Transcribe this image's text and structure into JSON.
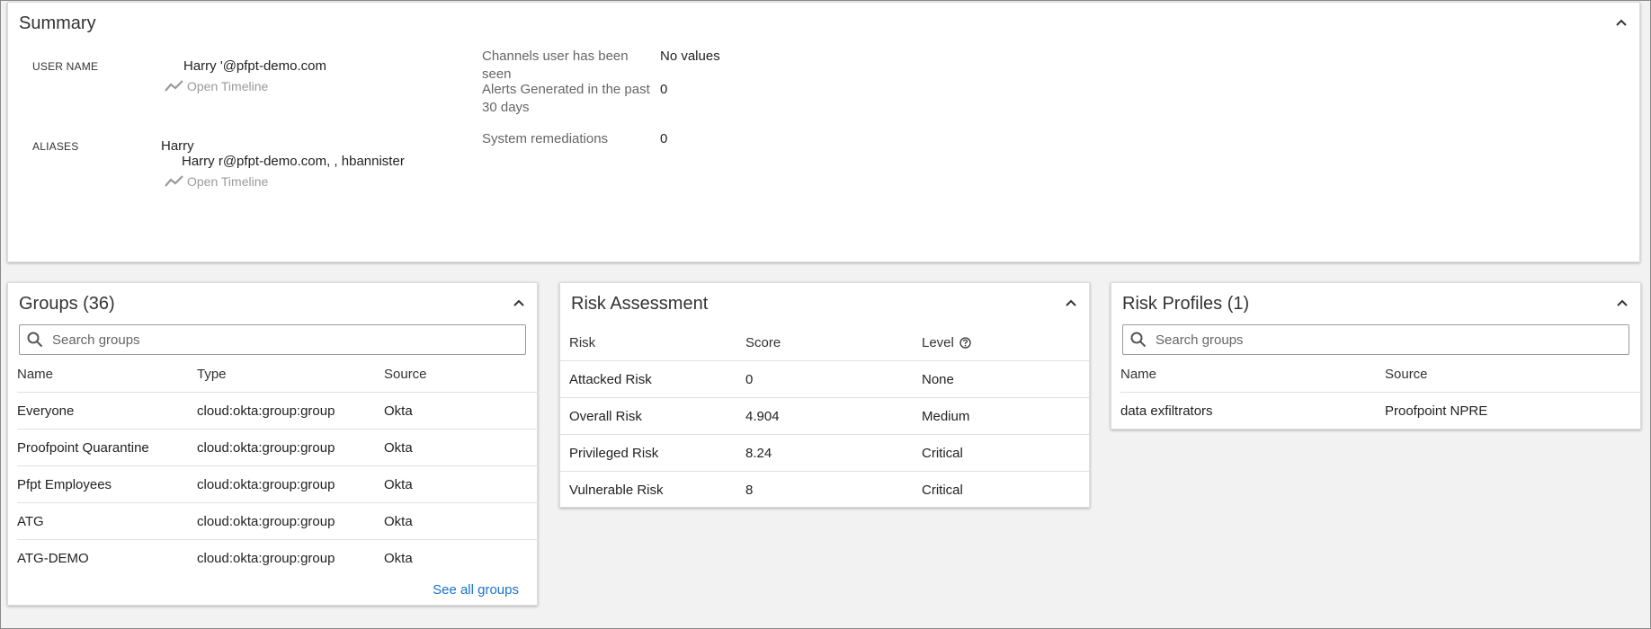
{
  "summary": {
    "title": "Summary",
    "user_name_label": "USER NAME",
    "user_name_value": "Harry '@pfpt-demo.com",
    "open_timeline": "Open Timeline",
    "aliases_label": "ALIASES",
    "aliases_line1": "Harry",
    "aliases_line2": "Harry r@pfpt-demo.com, , hbannister",
    "stats": [
      {
        "label": "Channels user has been seen",
        "value": "No values"
      },
      {
        "label": "Alerts Generated in the past 30 days",
        "value": "0"
      },
      {
        "label": "System remediations",
        "value": "0"
      }
    ]
  },
  "groups": {
    "title": "Groups (36)",
    "search_placeholder": "Search groups",
    "columns": [
      "Name",
      "Type",
      "Source"
    ],
    "rows": [
      [
        "Everyone",
        "cloud:okta:group:group",
        "Okta"
      ],
      [
        "Proofpoint Quarantine",
        "cloud:okta:group:group",
        "Okta"
      ],
      [
        "Pfpt Employees",
        "cloud:okta:group:group",
        "Okta"
      ],
      [
        "ATG",
        "cloud:okta:group:group",
        "Okta"
      ],
      [
        "ATG-DEMO",
        "cloud:okta:group:group",
        "Okta"
      ]
    ],
    "see_all": "See all groups"
  },
  "risk": {
    "title": "Risk Assessment",
    "columns": [
      "Risk",
      "Score",
      "Level"
    ],
    "rows": [
      [
        "Attacked Risk",
        "0",
        "None"
      ],
      [
        "Overall Risk",
        "4.904",
        "Medium"
      ],
      [
        "Privileged Risk",
        "8.24",
        "Critical"
      ],
      [
        "Vulnerable Risk",
        "8",
        "Critical"
      ]
    ]
  },
  "profiles": {
    "title": "Risk Profiles (1)",
    "search_placeholder": "Search groups",
    "columns": [
      "Name",
      "Source"
    ],
    "rows": [
      [
        "data exfiltrators",
        "Proofpoint NPRE"
      ]
    ]
  },
  "colors": {
    "link": "#1a73c9",
    "muted": "#9a9a9a",
    "background": "#f2f2f2"
  }
}
